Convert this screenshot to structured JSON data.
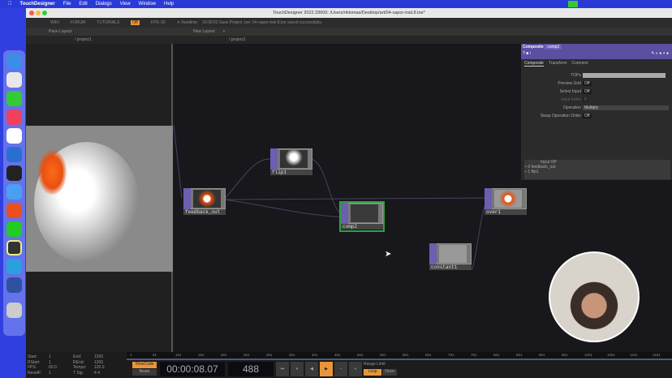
{
  "menubar": {
    "app": "TouchDesigner",
    "items": [
      "File",
      "Edit",
      "Dialogs",
      "View",
      "Window",
      "Help"
    ]
  },
  "window": {
    "title": "TouchDesigner 2022.33600: /Users/riklomas/Desktop/art/04-vapor-trail.8.toe*"
  },
  "toolbar": {
    "wiki": "WIKI",
    "forum": "FORUM",
    "tutorials": "TUTORIALS",
    "off": "Off",
    "fps_label": "FPS:",
    "fps": "50",
    "realtime": "Realtime",
    "status": "16:00:52 Save Project .toe: 04-vapor-trail.8.toe saved successfully."
  },
  "panebar": {
    "pane_layout": "Pane Layout",
    "new_layout": "New Layout",
    "plus": "+"
  },
  "path": {
    "left": "/ project1",
    "right": "/ project1"
  },
  "nodes": [
    {
      "name": "flip1"
    },
    {
      "name": "feedback_out"
    },
    {
      "name": "comp2"
    },
    {
      "name": "over1"
    },
    {
      "name": "constant1"
    }
  ],
  "params": {
    "type": "Composite",
    "name": "comp2",
    "tabs": [
      "Composite",
      "Transform",
      "Common"
    ],
    "rows": [
      {
        "label": "TOPs",
        "value": ""
      },
      {
        "label": "Preview Grid",
        "value": "Off"
      },
      {
        "label": "Select Input",
        "value": "Off"
      },
      {
        "label": "Input Index",
        "value": "0"
      },
      {
        "label": "Operation",
        "value": "Multiply"
      },
      {
        "label": "Swap Operation Order",
        "value": "Off"
      }
    ],
    "input_header": "Input OP",
    "inputs": [
      {
        "index": "0",
        "name": "feedback_out"
      },
      {
        "index": "1",
        "name": "flip1"
      }
    ]
  },
  "timeline": {
    "start_label": "Start:",
    "start": "1",
    "end_label": "End:",
    "end": "1200",
    "rstart_label": "RStart:",
    "rstart": "1",
    "rend_label": "REnd:",
    "rend": "1200",
    "fps_label": "FPS:",
    "fps": "60.0",
    "tempo_label": "Tempo:",
    "tempo": "120.0",
    "resetf_label": "ResetF:",
    "resetf": "1",
    "tsig_label": "T Sig:",
    "tsig": "4    4",
    "timecode_btn": "TimeCode",
    "beats_btn": "Beats",
    "timecode": "00:00:08.07",
    "frame": "488",
    "range_limit": "Range Limit",
    "loop": "Loop",
    "once": "Once",
    "ticks": [
      "1",
      "51",
      "101",
      "151",
      "201",
      "251",
      "301",
      "351",
      "401",
      "451",
      "501",
      "551",
      "601",
      "651",
      "701",
      "751",
      "801",
      "851",
      "901",
      "951",
      "1001",
      "1051",
      "1101",
      "1151"
    ]
  },
  "colors": {
    "desktop": "#2f3fe0",
    "accent": "#e8963a",
    "node_side": "#6a5fb0",
    "selected": "#2fa040"
  }
}
